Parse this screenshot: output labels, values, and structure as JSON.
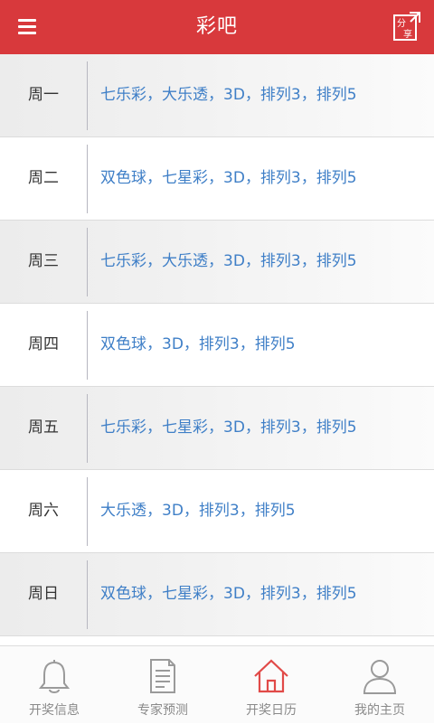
{
  "header": {
    "title": "彩吧",
    "share_label": "分享"
  },
  "colors": {
    "brand": "#d8393c",
    "link": "#3f7fc7",
    "active_icon": "#e14a48"
  },
  "schedule": [
    {
      "day": "周一",
      "lotteries": "七乐彩，大乐透，3D，排列3，排列5"
    },
    {
      "day": "周二",
      "lotteries": "双色球，七星彩，3D，排列3，排列5"
    },
    {
      "day": "周三",
      "lotteries": "七乐彩，大乐透，3D，排列3，排列5"
    },
    {
      "day": "周四",
      "lotteries": "双色球，3D，排列3，排列5"
    },
    {
      "day": "周五",
      "lotteries": "七乐彩，七星彩，3D，排列3，排列5"
    },
    {
      "day": "周六",
      "lotteries": "大乐透，3D，排列3，排列5"
    },
    {
      "day": "周日",
      "lotteries": "双色球，七星彩，3D，排列3，排列5"
    }
  ],
  "tabs": [
    {
      "label": "开奖信息",
      "icon": "bell-icon"
    },
    {
      "label": "专家预测",
      "icon": "document-icon"
    },
    {
      "label": "开奖日历",
      "icon": "home-icon",
      "active": true
    },
    {
      "label": "我的主页",
      "icon": "user-icon"
    }
  ]
}
